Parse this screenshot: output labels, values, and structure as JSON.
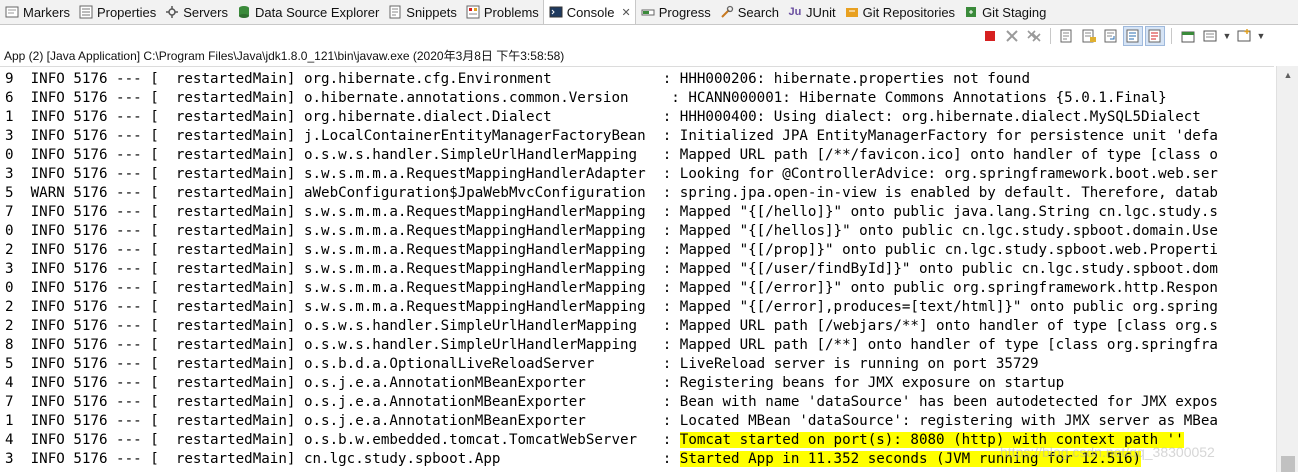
{
  "tabs": [
    {
      "label": "Markers",
      "icon": "markers-icon"
    },
    {
      "label": "Properties",
      "icon": "properties-icon"
    },
    {
      "label": "Servers",
      "icon": "servers-icon"
    },
    {
      "label": "Data Source Explorer",
      "icon": "data-source-explorer-icon"
    },
    {
      "label": "Snippets",
      "icon": "snippets-icon"
    },
    {
      "label": "Problems",
      "icon": "problems-icon"
    },
    {
      "label": "Console",
      "icon": "console-icon",
      "active": true,
      "close": "✕"
    },
    {
      "label": "Progress",
      "icon": "progress-icon"
    },
    {
      "label": "Search",
      "icon": "search-icon"
    },
    {
      "label": "JUnit",
      "icon": "junit-icon"
    },
    {
      "label": "Git Repositories",
      "icon": "git-repositories-icon"
    },
    {
      "label": "Git Staging",
      "icon": "git-staging-icon"
    }
  ],
  "console_header": "App (2) [Java Application] C:\\Program Files\\Java\\jdk1.8.0_121\\bin\\javaw.exe (2020年3月8日 下午3:58:58)",
  "lines": [
    {
      "n": "9",
      "level": "INFO",
      "pid": "5176",
      "thread": " restartedMain",
      "logger": "org.hibernate.cfg.Environment            ",
      "msg": "HHH000206: hibernate.properties not found"
    },
    {
      "n": "6",
      "level": "INFO",
      "pid": "5176",
      "thread": " restartedMain",
      "logger": "o.hibernate.annotations.common.Version    ",
      "msg": "HCANN000001: Hibernate Commons Annotations {5.0.1.Final}"
    },
    {
      "n": "1",
      "level": "INFO",
      "pid": "5176",
      "thread": " restartedMain",
      "logger": "org.hibernate.dialect.Dialect            ",
      "msg": "HHH000400: Using dialect: org.hibernate.dialect.MySQL5Dialect"
    },
    {
      "n": "3",
      "level": "INFO",
      "pid": "5176",
      "thread": " restartedMain",
      "logger": "j.LocalContainerEntityManagerFactoryBean ",
      "msg": "Initialized JPA EntityManagerFactory for persistence unit 'defa"
    },
    {
      "n": "0",
      "level": "INFO",
      "pid": "5176",
      "thread": " restartedMain",
      "logger": "o.s.w.s.handler.SimpleUrlHandlerMapping  ",
      "msg": "Mapped URL path [/**/favicon.ico] onto handler of type [class o"
    },
    {
      "n": "3",
      "level": "INFO",
      "pid": "5176",
      "thread": " restartedMain",
      "logger": "s.w.s.m.m.a.RequestMappingHandlerAdapter ",
      "msg": "Looking for @ControllerAdvice: org.springframework.boot.web.ser"
    },
    {
      "n": "5",
      "level": "WARN",
      "pid": "5176",
      "thread": " restartedMain",
      "logger": "aWebConfiguration$JpaWebMvcConfiguration ",
      "msg": "spring.jpa.open-in-view is enabled by default. Therefore, datab"
    },
    {
      "n": "7",
      "level": "INFO",
      "pid": "5176",
      "thread": " restartedMain",
      "logger": "s.w.s.m.m.a.RequestMappingHandlerMapping ",
      "msg": "Mapped \"{[/hello]}\" onto public java.lang.String cn.lgc.study.s"
    },
    {
      "n": "0",
      "level": "INFO",
      "pid": "5176",
      "thread": " restartedMain",
      "logger": "s.w.s.m.m.a.RequestMappingHandlerMapping ",
      "msg": "Mapped \"{[/hellos]}\" onto public cn.lgc.study.spboot.domain.Use"
    },
    {
      "n": "2",
      "level": "INFO",
      "pid": "5176",
      "thread": " restartedMain",
      "logger": "s.w.s.m.m.a.RequestMappingHandlerMapping ",
      "msg": "Mapped \"{[/prop]}\" onto public cn.lgc.study.spboot.web.Properti"
    },
    {
      "n": "3",
      "level": "INFO",
      "pid": "5176",
      "thread": " restartedMain",
      "logger": "s.w.s.m.m.a.RequestMappingHandlerMapping ",
      "msg": "Mapped \"{[/user/findById]}\" onto public cn.lgc.study.spboot.dom"
    },
    {
      "n": "0",
      "level": "INFO",
      "pid": "5176",
      "thread": " restartedMain",
      "logger": "s.w.s.m.m.a.RequestMappingHandlerMapping ",
      "msg": "Mapped \"{[/error]}\" onto public org.springframework.http.Respon"
    },
    {
      "n": "2",
      "level": "INFO",
      "pid": "5176",
      "thread": " restartedMain",
      "logger": "s.w.s.m.m.a.RequestMappingHandlerMapping ",
      "msg": "Mapped \"{[/error],produces=[text/html]}\" onto public org.spring"
    },
    {
      "n": "2",
      "level": "INFO",
      "pid": "5176",
      "thread": " restartedMain",
      "logger": "o.s.w.s.handler.SimpleUrlHandlerMapping  ",
      "msg": "Mapped URL path [/webjars/**] onto handler of type [class org.s"
    },
    {
      "n": "8",
      "level": "INFO",
      "pid": "5176",
      "thread": " restartedMain",
      "logger": "o.s.w.s.handler.SimpleUrlHandlerMapping  ",
      "msg": "Mapped URL path [/**] onto handler of type [class org.springfra"
    },
    {
      "n": "5",
      "level": "INFO",
      "pid": "5176",
      "thread": " restartedMain",
      "logger": "o.s.b.d.a.OptionalLiveReloadServer       ",
      "msg": "LiveReload server is running on port 35729"
    },
    {
      "n": "4",
      "level": "INFO",
      "pid": "5176",
      "thread": " restartedMain",
      "logger": "o.s.j.e.a.AnnotationMBeanExporter        ",
      "msg": "Registering beans for JMX exposure on startup"
    },
    {
      "n": "7",
      "level": "INFO",
      "pid": "5176",
      "thread": " restartedMain",
      "logger": "o.s.j.e.a.AnnotationMBeanExporter        ",
      "msg": "Bean with name 'dataSource' has been autodetected for JMX expos"
    },
    {
      "n": "1",
      "level": "INFO",
      "pid": "5176",
      "thread": " restartedMain",
      "logger": "o.s.j.e.a.AnnotationMBeanExporter        ",
      "msg": "Located MBean 'dataSource': registering with JMX server as MBea"
    },
    {
      "n": "4",
      "level": "INFO",
      "pid": "5176",
      "thread": " restartedMain",
      "logger": "o.s.b.w.embedded.tomcat.TomcatWebServer  ",
      "msg": "Tomcat started on port(s): 8080 (http) with context path ''",
      "highlight": true
    },
    {
      "n": "3",
      "level": "INFO",
      "pid": "5176",
      "thread": " restartedMain",
      "logger": "cn.lgc.study.spboot.App                  ",
      "msg": "Started App in 11.352 seconds (JVM running for 12.516)",
      "highlight": true
    }
  ],
  "watermark": "https://blog.csdn.net/qq_38300052",
  "colors": {
    "highlight": "#ffff00",
    "tabbar_bg": "#f2f2f2",
    "terminate_red": "#d62020"
  }
}
